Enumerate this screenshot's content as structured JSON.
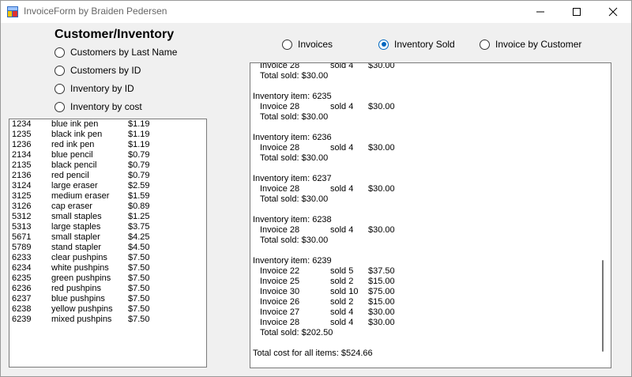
{
  "window": {
    "title": "InvoiceForm by Braiden Pedersen"
  },
  "left_panel": {
    "heading": "Customer/Inventory",
    "radios": [
      {
        "label": "Customers by Last Name",
        "selected": false
      },
      {
        "label": "Customers by ID",
        "selected": false
      },
      {
        "label": "Inventory by ID",
        "selected": false
      },
      {
        "label": "Inventory by cost",
        "selected": false
      }
    ],
    "list": [
      {
        "id": "1234",
        "name": "blue ink pen",
        "price": "$1.19"
      },
      {
        "id": "1235",
        "name": "black ink pen",
        "price": "$1.19"
      },
      {
        "id": "1236",
        "name": "red ink pen",
        "price": "$1.19"
      },
      {
        "id": "2134",
        "name": "blue pencil",
        "price": "$0.79"
      },
      {
        "id": "2135",
        "name": "black pencil",
        "price": "$0.79"
      },
      {
        "id": "2136",
        "name": "red pencil",
        "price": "$0.79"
      },
      {
        "id": "3124",
        "name": "large eraser",
        "price": "$2.59"
      },
      {
        "id": "3125",
        "name": "medium eraser",
        "price": "$1.59"
      },
      {
        "id": "3126",
        "name": "cap eraser",
        "price": "$0.89"
      },
      {
        "id": "5312",
        "name": "small staples",
        "price": "$1.25"
      },
      {
        "id": "5313",
        "name": "large staples",
        "price": "$3.75"
      },
      {
        "id": "5671",
        "name": "small stapler",
        "price": "$4.25"
      },
      {
        "id": "5789",
        "name": "stand stapler",
        "price": "$4.50"
      },
      {
        "id": "6233",
        "name": "clear pushpins",
        "price": "$7.50"
      },
      {
        "id": "6234",
        "name": "white pushpins",
        "price": "$7.50"
      },
      {
        "id": "6235",
        "name": "green pushpins",
        "price": "$7.50"
      },
      {
        "id": "6236",
        "name": "red pushpins",
        "price": "$7.50"
      },
      {
        "id": "6237",
        "name": "blue pushpins",
        "price": "$7.50"
      },
      {
        "id": "6238",
        "name": "yellow pushpins",
        "price": "$7.50"
      },
      {
        "id": "6239",
        "name": "mixed pushpins",
        "price": "$7.50"
      }
    ]
  },
  "right_panel": {
    "radios": [
      {
        "label": "Invoices",
        "selected": false
      },
      {
        "label": "Inventory Sold",
        "selected": true
      },
      {
        "label": "Invoice by Customer",
        "selected": false
      }
    ],
    "report_lines": [
      {
        "kind": "row",
        "invoice": "Invoice 28",
        "sold": "sold 4",
        "amount": "$30.00"
      },
      {
        "kind": "text",
        "text": "Total sold: $30.00",
        "indent": true
      },
      {
        "kind": "blank"
      },
      {
        "kind": "text",
        "text": "Inventory item: 6235"
      },
      {
        "kind": "row",
        "invoice": "Invoice 28",
        "sold": "sold 4",
        "amount": "$30.00"
      },
      {
        "kind": "text",
        "text": "Total sold: $30.00",
        "indent": true
      },
      {
        "kind": "blank"
      },
      {
        "kind": "text",
        "text": "Inventory item: 6236"
      },
      {
        "kind": "row",
        "invoice": "Invoice 28",
        "sold": "sold 4",
        "amount": "$30.00"
      },
      {
        "kind": "text",
        "text": "Total sold: $30.00",
        "indent": true
      },
      {
        "kind": "blank"
      },
      {
        "kind": "text",
        "text": "Inventory item: 6237"
      },
      {
        "kind": "row",
        "invoice": "Invoice 28",
        "sold": "sold 4",
        "amount": "$30.00"
      },
      {
        "kind": "text",
        "text": "Total sold: $30.00",
        "indent": true
      },
      {
        "kind": "blank"
      },
      {
        "kind": "text",
        "text": "Inventory item: 6238"
      },
      {
        "kind": "row",
        "invoice": "Invoice 28",
        "sold": "sold 4",
        "amount": "$30.00"
      },
      {
        "kind": "text",
        "text": "Total sold: $30.00",
        "indent": true
      },
      {
        "kind": "blank"
      },
      {
        "kind": "text",
        "text": "Inventory item: 6239"
      },
      {
        "kind": "row",
        "invoice": "Invoice 22",
        "sold": "sold 5",
        "amount": "$37.50"
      },
      {
        "kind": "row",
        "invoice": "Invoice 25",
        "sold": "sold 2",
        "amount": "$15.00"
      },
      {
        "kind": "row",
        "invoice": "Invoice 30",
        "sold": "sold 10",
        "amount": "$75.00"
      },
      {
        "kind": "row",
        "invoice": "Invoice 26",
        "sold": "sold 2",
        "amount": "$15.00"
      },
      {
        "kind": "row",
        "invoice": "Invoice 27",
        "sold": "sold 4",
        "amount": "$30.00"
      },
      {
        "kind": "row",
        "invoice": "Invoice 28",
        "sold": "sold 4",
        "amount": "$30.00"
      },
      {
        "kind": "text",
        "text": "Total sold: $202.50",
        "indent": true
      },
      {
        "kind": "blank"
      },
      {
        "kind": "text",
        "text": "Total cost for all items: $524.66"
      }
    ]
  },
  "colors": {
    "accent": "#0067c0",
    "background": "#f0f0f0",
    "titlebar": "#ffffff"
  },
  "icons": [
    "app-icon",
    "minimize-icon",
    "maximize-icon",
    "close-icon"
  ]
}
